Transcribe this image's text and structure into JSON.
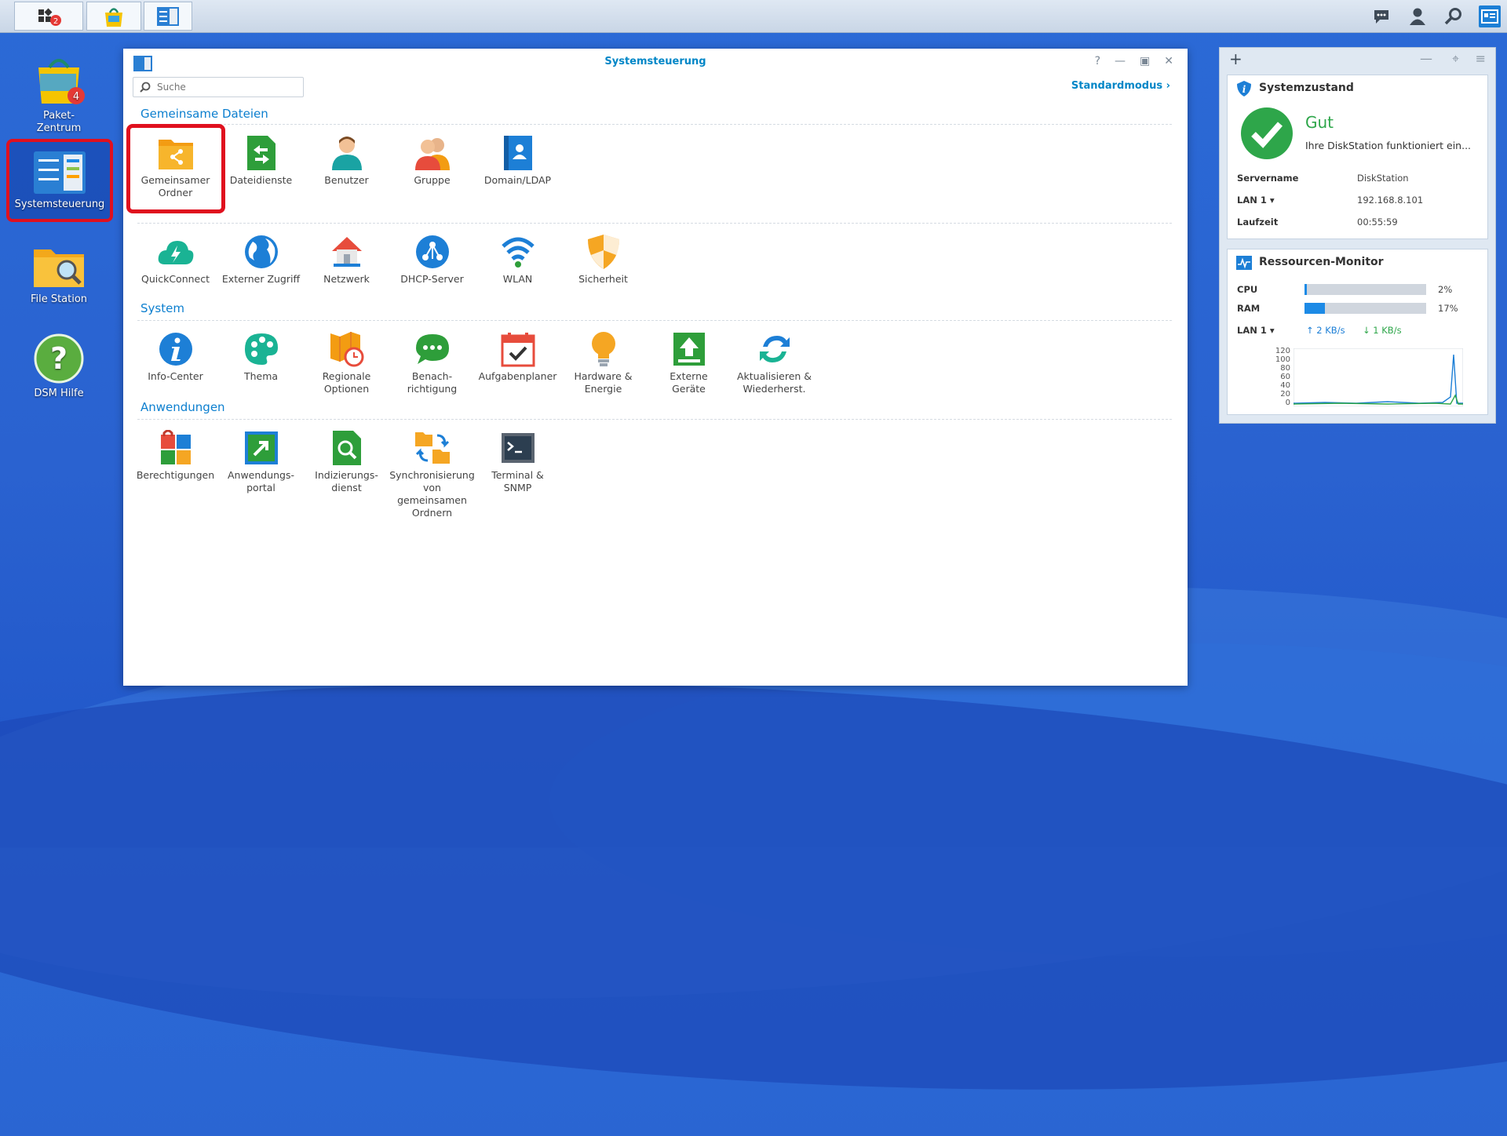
{
  "taskbar": {
    "notifications_badge": "2",
    "right_icons": [
      "chat-icon",
      "user-icon",
      "search-icon",
      "widgets-icon"
    ]
  },
  "desktop": {
    "items": [
      {
        "label": "Paket-\nZentrum",
        "badge": "4"
      },
      {
        "label": "Systemsteuerung"
      },
      {
        "label": "File Station"
      },
      {
        "label": "DSM Hilfe"
      }
    ]
  },
  "window": {
    "title": "Systemsteuerung",
    "search_placeholder": "Suche",
    "mode_label": "Standardmodus",
    "sections": [
      {
        "title": "Gemeinsame Dateien",
        "items": [
          "Gemeinsamer\nOrdner",
          "Dateidienste",
          "Benutzer",
          "Gruppe",
          "Domain/LDAP"
        ]
      },
      {
        "title": "",
        "items": [
          "QuickConnect",
          "Externer Zugriff",
          "Netzwerk",
          "DHCP-Server",
          "WLAN",
          "Sicherheit"
        ]
      },
      {
        "title": "System",
        "items": [
          "Info-Center",
          "Thema",
          "Regionale\nOptionen",
          "Benach-\nrichtigung",
          "Aufgabenplaner",
          "Hardware &\nEnergie",
          "Externe\nGeräte",
          "Aktualisieren &\nWiederherst."
        ]
      },
      {
        "title": "Anwendungen",
        "items": [
          "Berechtigungen",
          "Anwendungs-\nportal",
          "Indizierungs-\ndienst",
          "Synchronisierung\nvon\ngemeinsamen\nOrdnern",
          "Terminal &\nSNMP"
        ]
      }
    ]
  },
  "widgets": {
    "systemzustand": {
      "title": "Systemzustand",
      "status": "Gut",
      "message": "Ihre DiskStation funktioniert ein...",
      "rows": [
        {
          "label": "Servername",
          "value": "DiskStation"
        },
        {
          "label": "LAN 1 ▾",
          "value": "192.168.8.101"
        },
        {
          "label": "Laufzeit",
          "value": "00:55:59"
        }
      ]
    },
    "ressourcen": {
      "title": "Ressourcen-Monitor",
      "cpu_label": "CPU",
      "cpu_value": "2%",
      "cpu_fraction": 0.02,
      "ram_label": "RAM",
      "ram_value": "17%",
      "ram_fraction": 0.17,
      "lan_label": "LAN 1 ▾",
      "lan_up": "2 KB/s",
      "lan_down": "1 KB/s",
      "chart_ticks": [
        "120",
        "100",
        "80",
        "60",
        "40",
        "20",
        "0"
      ]
    }
  }
}
